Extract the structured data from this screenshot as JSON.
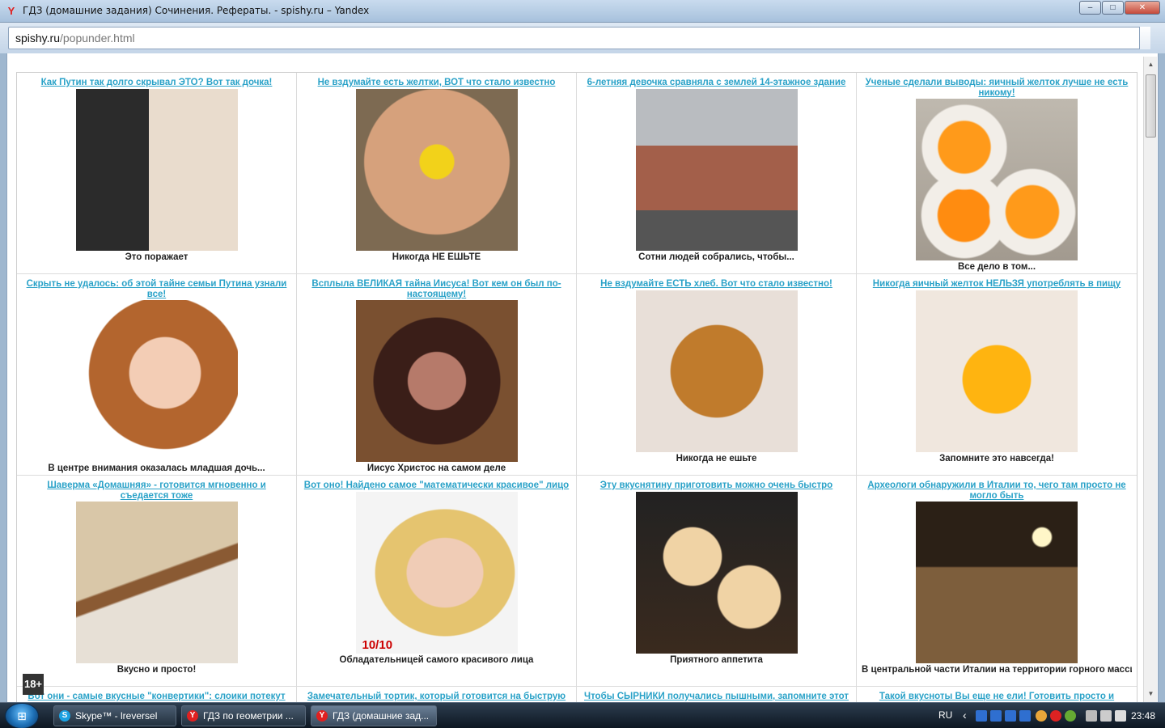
{
  "window": {
    "title": "ГДЗ (домашние задания) Сочинения. Рефераты. - spishy.ru – Yandex",
    "icon": "yandex-browser-icon",
    "controls": {
      "minimize": "–",
      "maximize": "□",
      "close": "✕"
    }
  },
  "address": {
    "domain": "spishy.ru",
    "path": "/popunder.html"
  },
  "page": {
    "age_badge": "18+",
    "cells": [
      {
        "headline": "Как Путин так долго скрывал ЭТО? Вот так дочка!",
        "caption": "Это поражает",
        "image": "putin-couple-photo"
      },
      {
        "headline": "Не вздумайте есть желтки, ВОТ что стало известно",
        "caption": "Никогда НЕ ЕШЬТЕ",
        "image": "yolk-on-hand-photo"
      },
      {
        "headline": "6-летняя девочка сравняла с землей 14-этажное здание",
        "caption": "Сотни людей собрались, чтобы...",
        "image": "building-collapse-photo"
      },
      {
        "headline": "Ученые сделали выводы: яичный желток лучше не есть никому!",
        "caption": "Все дело в том...",
        "image": "egg-yolks-in-shells-photo"
      },
      {
        "headline": "Скрыть не удалось: об этой тайне семьи Путина узнали все!",
        "caption": "В центре внимания оказалась младшая дочь...",
        "image": "red-haired-woman-photo"
      },
      {
        "headline": "Всплыла ВЕЛИКАЯ тайна Иисуса! Вот кем он был по-настоящему!",
        "caption": "Иисус Христос на самом деле",
        "image": "jesus-mosaic-photo"
      },
      {
        "headline": "Не вздумайте ЕСТЬ хлеб. Вот что стало известно!",
        "caption": "Никогда не ешьте",
        "image": "bread-loaf-photo"
      },
      {
        "headline": "Никогда яичный желток НЕЛЬЗЯ употреблять в пищу",
        "caption": "Запомните это навсегда!",
        "image": "raw-yolk-photo"
      },
      {
        "headline": "Шаверма «Домашняя» - готовится мгновенно и съедается тоже",
        "caption": "Вкусно и просто!",
        "image": "shawarma-photo"
      },
      {
        "headline": "Вот оно! Найдено самое \"математически красивое\" лицо",
        "caption": "Обладательницей самого красивого лица",
        "image": "beautiful-face-grid-photo",
        "overlay": "10/10"
      },
      {
        "headline": "Эту вкуснятину приготовить можно очень быстро",
        "caption": "Приятного аппетита",
        "image": "pastry-rolls-photo"
      },
      {
        "headline": "Археологи обнаружили в Италии то, чего там просто не могло быть",
        "caption": "В центральной части Италии на территории горного массива",
        "image": "cave-archaeologists-photo"
      },
      {
        "headline": "Вот они - самые вкусные \"конвертики\": слоики потекут",
        "caption": "",
        "image": ""
      },
      {
        "headline": "Замечательный тортик, который готовится на быструю",
        "caption": "",
        "image": ""
      },
      {
        "headline": "Чтобы СЫРНИКИ получались пышными, запомните этот",
        "caption": "",
        "image": ""
      },
      {
        "headline": "Такой вкусноты Вы еще не ели! Готовить просто и",
        "caption": "",
        "image": ""
      }
    ]
  },
  "taskbar": {
    "start": "start-orb-icon",
    "tasks": [
      {
        "label": "Skype™ - lreversel",
        "icon": "skype-icon",
        "color": "#1ba1e2"
      },
      {
        "label": "ГДЗ по геометрии ...",
        "icon": "yandex-icon",
        "color": "#e02020"
      },
      {
        "label": "ГДЗ (домашние зад...",
        "icon": "yandex-icon",
        "color": "#e02020"
      }
    ],
    "lang": "RU",
    "time": "23:48"
  }
}
